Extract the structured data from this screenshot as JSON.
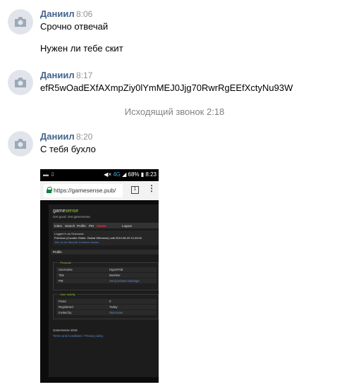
{
  "messages": [
    {
      "author": "Даниил",
      "time": "8:06",
      "lines": [
        "Срочно отвечай",
        "Нужен ли тебе скит"
      ]
    },
    {
      "author": "Даниил",
      "time": "8:17",
      "lines": [
        "efR5wOadEXfAXmpZiy0lYmMEJ0Jjg70RwrRgEEfXctyNu93W"
      ]
    },
    {
      "author": "Даниил",
      "time": "8:20",
      "lines": [
        "С тебя бухло"
      ]
    }
  ],
  "call_notice": "Исходящий звонок 2:18",
  "screenshot": {
    "status_bar": {
      "left": "▬ ⇩",
      "network": "4G",
      "battery": "68%",
      "clock": "8:23"
    },
    "url": "https://gamesense.pub/",
    "tabs_count": "1",
    "site": {
      "brand_a": "game",
      "brand_b": "sense",
      "tagline": "Get good. Get gamesense.",
      "nav": [
        "Index",
        "Search",
        "Profile",
        "PM",
        "Logout"
      ],
      "login_lines": [
        "Logged in as Skurusaw",
        "Premium (Counter-Strike: Global Offensive) until 2019-08-09 12:40:00",
        "Join us on discord!   Common issues"
      ],
      "profile_title": "Profile",
      "personal_heading": "Personal",
      "personal": [
        {
          "key": "Username",
          "value": "HyperFnik",
          "link": false
        },
        {
          "key": "Title",
          "value": "Member",
          "link": false
        },
        {
          "key": "PM",
          "value": "Send private message",
          "link": true
        }
      ],
      "activity_heading": "User activity",
      "activity": [
        {
          "key": "Posts",
          "value": "0",
          "link": false
        },
        {
          "key": "Registered",
          "value": "Today",
          "link": false
        },
        {
          "key": "Invited by",
          "value": "Skurusaw",
          "link": true
        }
      ],
      "footer": [
        "GameSense 2018",
        "Terms and Conditions / Privacy policy"
      ]
    }
  },
  "colors": {
    "author": "#42648b",
    "time": "#939393",
    "notice": "#828282",
    "avatar_bg": "#e1e5eb"
  }
}
